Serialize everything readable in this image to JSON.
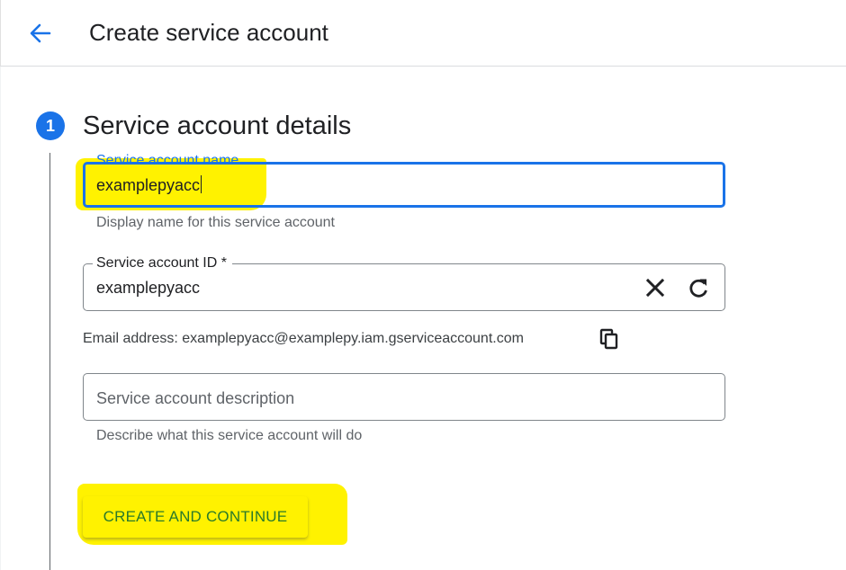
{
  "header": {
    "back_icon": "arrow-back-icon",
    "title": "Create service account"
  },
  "step": {
    "number": "1",
    "title": "Service account details"
  },
  "fields": {
    "name": {
      "label": "Service account name",
      "value": "examplepyacc",
      "hint": "Display name for this service account"
    },
    "id": {
      "label": "Service account ID *",
      "value": "examplepyacc",
      "clear_icon": "close-icon",
      "refresh_icon": "refresh-icon"
    },
    "email": {
      "text": "Email address: examplepyacc@examplepy.iam.gserviceaccount.com",
      "copy_icon": "copy-icon"
    },
    "description": {
      "placeholder": "Service account description",
      "hint": "Describe what this service account will do"
    }
  },
  "actions": {
    "create_label": "CREATE AND CONTINUE"
  },
  "colors": {
    "accent": "#1a73e8",
    "highlight": "#fff200",
    "button_text": "#2a7a2a"
  }
}
